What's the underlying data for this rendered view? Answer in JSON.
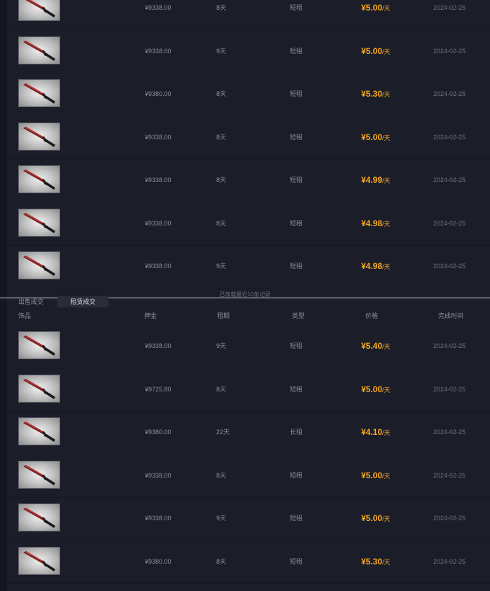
{
  "colors": {
    "background": "#1b1e28",
    "price_accent": "#f5a623",
    "divider": "#d9dbe0",
    "active_tab": "#2a2d38"
  },
  "top_rows": [
    {
      "deposit": "¥9338.00",
      "period": "8天",
      "type": "短租",
      "price": "¥5.00",
      "unit": "/天",
      "date": "2024-02-25"
    },
    {
      "deposit": "¥9338.00",
      "period": "9天",
      "type": "短租",
      "price": "¥5.00",
      "unit": "/天",
      "date": "2024-02-25"
    },
    {
      "deposit": "¥9380.00",
      "period": "8天",
      "type": "短租",
      "price": "¥5.30",
      "unit": "/天",
      "date": "2024-02-25"
    },
    {
      "deposit": "¥9338.00",
      "period": "8天",
      "type": "短租",
      "price": "¥5.00",
      "unit": "/天",
      "date": "2024-02-25"
    },
    {
      "deposit": "¥9338.00",
      "period": "8天",
      "type": "短租",
      "price": "¥4.99",
      "unit": "/天",
      "date": "2024-02-25"
    },
    {
      "deposit": "¥9338.00",
      "period": "8天",
      "type": "短租",
      "price": "¥4.98",
      "unit": "/天",
      "date": "2024-02-25"
    },
    {
      "deposit": "¥9338.00",
      "period": "9天",
      "type": "短租",
      "price": "¥4.98",
      "unit": "/天",
      "date": "2024-02-25"
    }
  ],
  "loaded_note": "已加载最近10条记录",
  "tabs": {
    "sale": "出售成交",
    "rent": "租赁成交"
  },
  "columns": {
    "item": "饰品",
    "deposit": "押金",
    "period": "租期",
    "type": "类型",
    "price": "价格",
    "time": "完成时间"
  },
  "bottom_rows": [
    {
      "deposit": "¥9338.00",
      "period": "9天",
      "type": "短租",
      "price": "¥5.40",
      "unit": "/天",
      "date": "2024-02-25"
    },
    {
      "deposit": "¥9725.80",
      "period": "8天",
      "type": "短租",
      "price": "¥5.00",
      "unit": "/天",
      "date": "2024-02-25"
    },
    {
      "deposit": "¥9380.00",
      "period": "22天",
      "type": "长租",
      "price": "¥4.10",
      "unit": "/天",
      "date": "2024-02-25"
    },
    {
      "deposit": "¥9338.00",
      "period": "8天",
      "type": "短租",
      "price": "¥5.00",
      "unit": "/天",
      "date": "2024-02-25"
    },
    {
      "deposit": "¥9338.00",
      "period": "9天",
      "type": "短租",
      "price": "¥5.00",
      "unit": "/天",
      "date": "2024-02-25"
    },
    {
      "deposit": "¥9380.00",
      "period": "8天",
      "type": "短租",
      "price": "¥5.30",
      "unit": "/天",
      "date": "2024-02-25"
    }
  ],
  "item_icon": "knife-skin-icon"
}
